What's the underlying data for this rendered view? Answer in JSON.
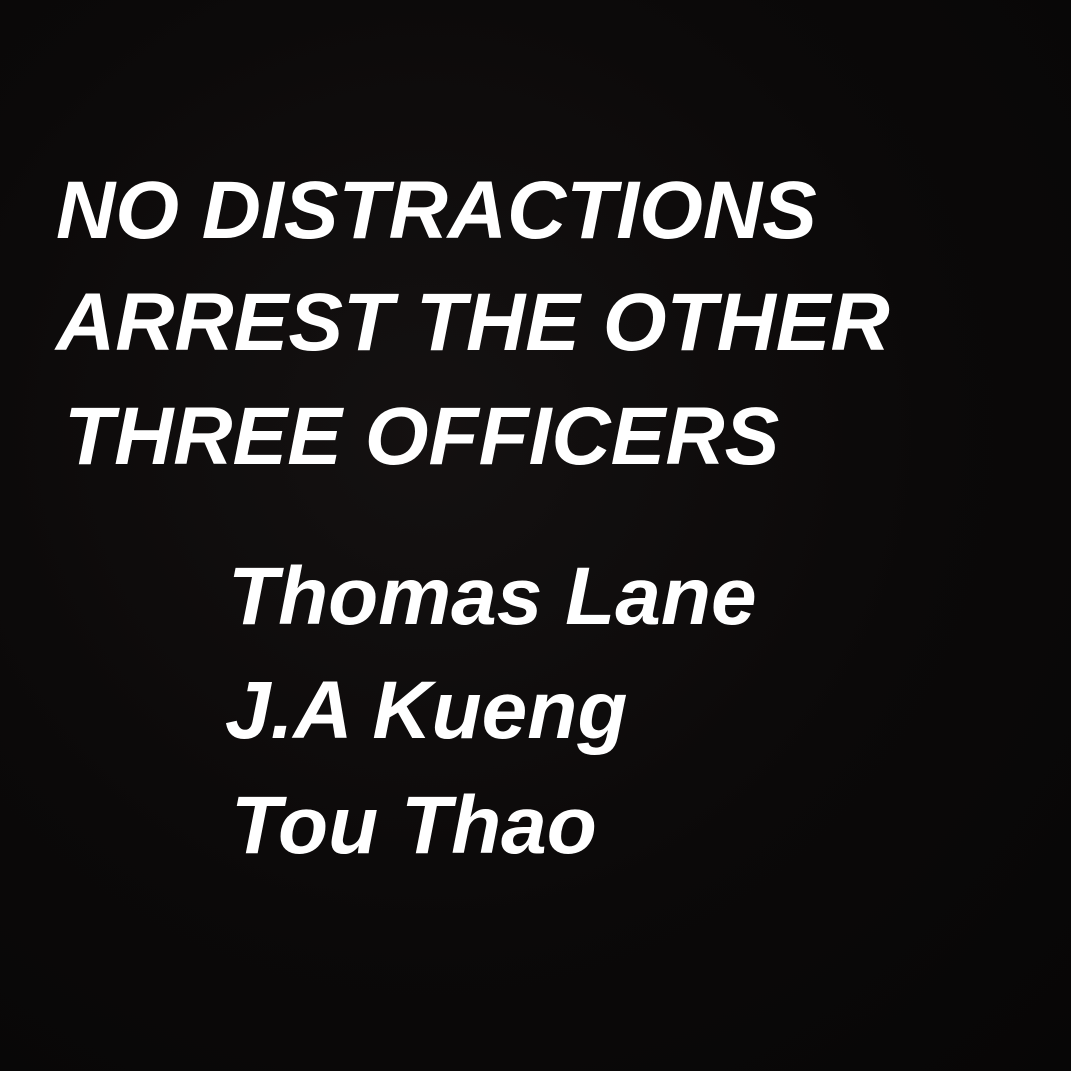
{
  "post": {
    "headline": [
      "NO DISTRACTIONS",
      "ARREST THE OTHER",
      "THREE OFFICERS"
    ],
    "names": [
      "Thomas Lane",
      "J.A Kueng",
      "Tou Thao"
    ],
    "colors": {
      "background": "#0b0909",
      "text": "#ffffff"
    }
  }
}
